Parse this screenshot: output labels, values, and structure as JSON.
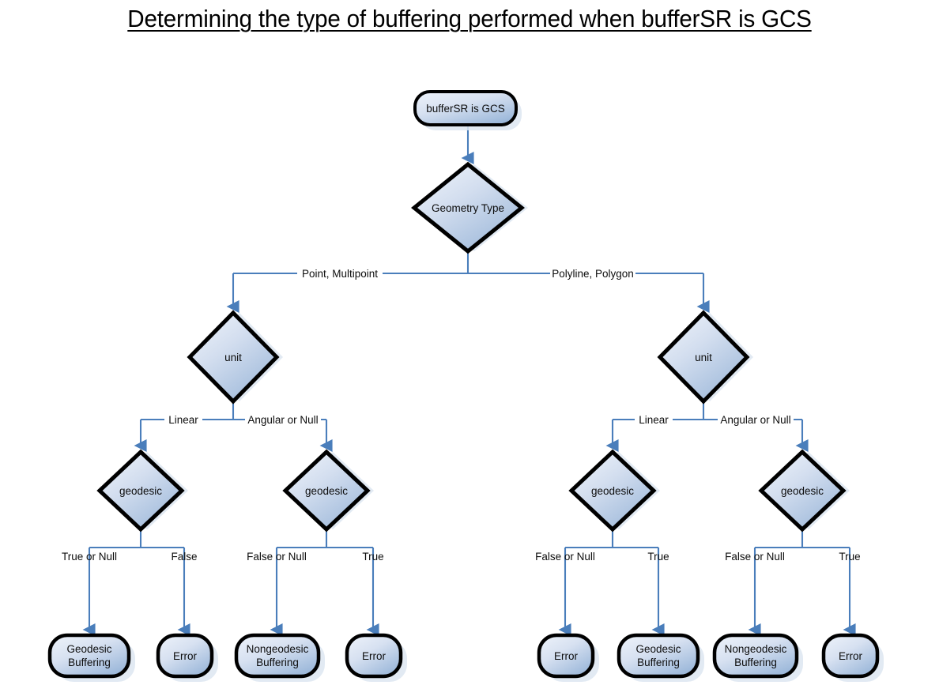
{
  "title": "Determining the type of buffering performed when bufferSR is GCS",
  "colors": {
    "connector": "#4a7ebb",
    "node_border": "#000000",
    "node_fill_light": "#e8eef7",
    "node_fill_dark": "#9bb7d9",
    "shadow": "#dde5f0",
    "text": "#0d0d0d",
    "background": "#ffffff"
  },
  "nodes": {
    "start": {
      "label": "bufferSR is GCS",
      "shape": "rounded-rect"
    },
    "geometry_type": {
      "label": "Geometry Type",
      "shape": "diamond"
    },
    "unit_left": {
      "label": "unit",
      "shape": "diamond"
    },
    "unit_right": {
      "label": "unit",
      "shape": "diamond"
    },
    "geodesic_1": {
      "label": "geodesic",
      "shape": "diamond"
    },
    "geodesic_2": {
      "label": "geodesic",
      "shape": "diamond"
    },
    "geodesic_3": {
      "label": "geodesic",
      "shape": "diamond"
    },
    "geodesic_4": {
      "label": "geodesic",
      "shape": "diamond"
    },
    "terminal_1": {
      "line1": "Geodesic",
      "line2": "Buffering",
      "shape": "rounded-rect"
    },
    "terminal_2": {
      "line1": "Error",
      "line2": "",
      "shape": "rounded-rect"
    },
    "terminal_3": {
      "line1": "Nongeodesic",
      "line2": "Buffering",
      "shape": "rounded-rect"
    },
    "terminal_4": {
      "line1": "Error",
      "line2": "",
      "shape": "rounded-rect"
    },
    "terminal_5": {
      "line1": "Error",
      "line2": "",
      "shape": "rounded-rect"
    },
    "terminal_6": {
      "line1": "Geodesic",
      "line2": "Buffering",
      "shape": "rounded-rect"
    },
    "terminal_7": {
      "line1": "Nongeodesic",
      "line2": "Buffering",
      "shape": "rounded-rect"
    },
    "terminal_8": {
      "line1": "Error",
      "line2": "",
      "shape": "rounded-rect"
    }
  },
  "edge_labels": {
    "geometry_left": "Point, Multipoint",
    "geometry_right": "Polyline, Polygon",
    "unit_left_linear": "Linear",
    "unit_left_angular": "Angular or Null",
    "unit_right_linear": "Linear",
    "unit_right_angular": "Angular or Null",
    "g1_left": "True or Null",
    "g1_right": "False",
    "g2_left": "False or Null",
    "g2_right": "True",
    "g3_left": "False or Null",
    "g3_right": "True",
    "g4_left": "False or Null",
    "g4_right": "True"
  }
}
